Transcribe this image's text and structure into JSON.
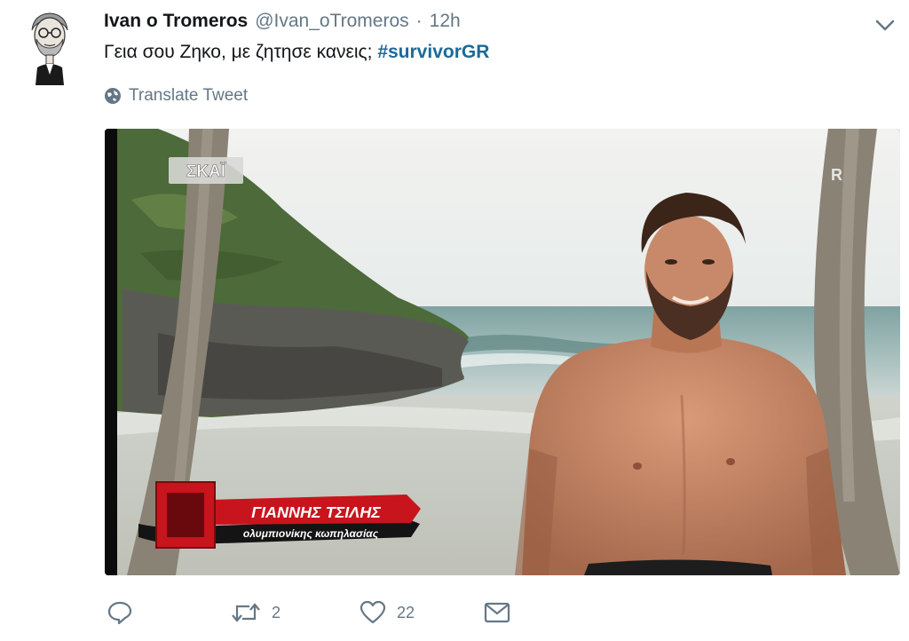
{
  "tweet": {
    "author_name": "Ivan o Tromeros",
    "handle": "@Ivan_oTromeros",
    "separator": "·",
    "time": "12h",
    "text": "Γεια σου Ζηκο, με ζητησε κανεις; ",
    "hashtag": "#survivorGR",
    "translate_label": "Translate Tweet"
  },
  "media": {
    "channel_logo": "ΣΚΑΪ",
    "lower_third_name": "ΓΙΑΝΝΗΣ ΤΣΙΛΗΣ",
    "lower_third_caption": "ολυμπιονίκης κωπηλασίας",
    "watermark_letter": "R"
  },
  "actions": {
    "reply_icon": "reply-icon",
    "retweet_icon": "retweet-icon",
    "retweet_count": "2",
    "like_icon": "heart-icon",
    "like_count": "22",
    "dm_icon": "envelope-icon"
  },
  "colors": {
    "hashtag": "#1b6a99",
    "secondary_text": "#657786",
    "lower_third_red": "#c8141c"
  }
}
